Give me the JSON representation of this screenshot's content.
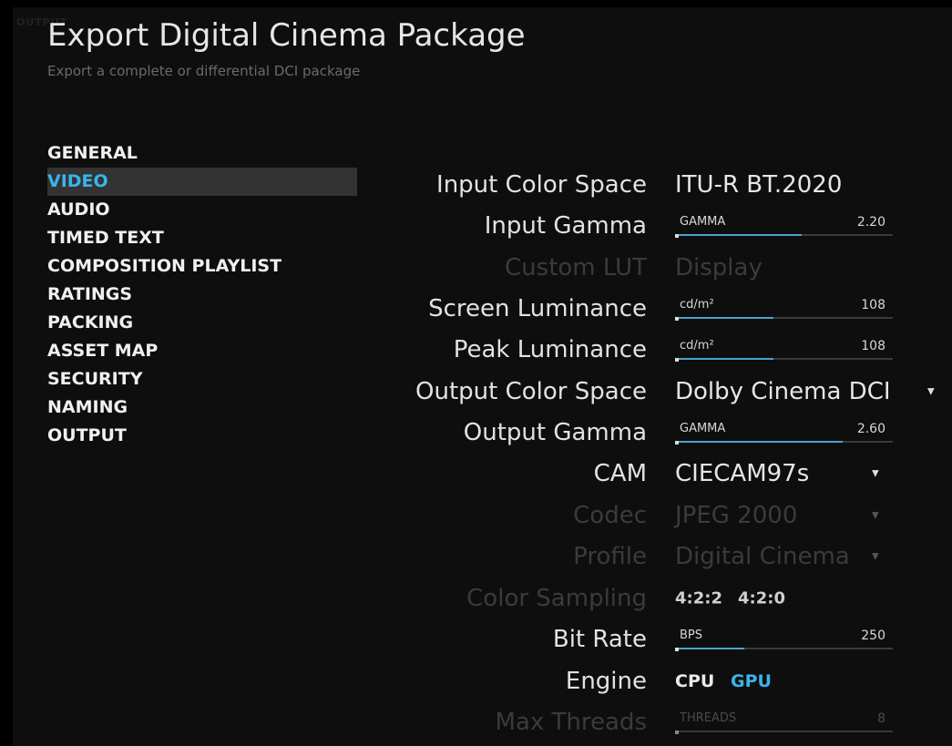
{
  "header": {
    "watermark": "OUTPUT",
    "title": "Export Digital Cinema Package",
    "subtitle": "Export a complete or differential DCI package"
  },
  "nav": {
    "items": [
      {
        "label": "GENERAL"
      },
      {
        "label": "VIDEO",
        "active": true
      },
      {
        "label": "AUDIO"
      },
      {
        "label": "TIMED TEXT"
      },
      {
        "label": "COMPOSITION PLAYLIST"
      },
      {
        "label": "RATINGS"
      },
      {
        "label": "PACKING"
      },
      {
        "label": "ASSET MAP"
      },
      {
        "label": "SECURITY"
      },
      {
        "label": "NAMING"
      },
      {
        "label": "OUTPUT"
      }
    ]
  },
  "settings": {
    "input_color_space": {
      "label": "Input Color Space",
      "value": "ITU-R BT.2020"
    },
    "input_gamma": {
      "label": "Input Gamma",
      "unit": "GAMMA",
      "value": "2.20",
      "fill": 0.58
    },
    "custom_lut": {
      "label": "Custom LUT",
      "value": "Display"
    },
    "screen_luminance": {
      "label": "Screen Luminance",
      "unit": "cd/m²",
      "value": "108",
      "fill": 0.45
    },
    "peak_luminance": {
      "label": "Peak Luminance",
      "unit": "cd/m²",
      "value": "108",
      "fill": 0.45
    },
    "output_color_space": {
      "label": "Output Color Space",
      "value": "Dolby Cinema DCI"
    },
    "output_gamma": {
      "label": "Output Gamma",
      "unit": "GAMMA",
      "value": "2.60",
      "fill": 0.77
    },
    "cam": {
      "label": "CAM",
      "value": "CIECAM97s"
    },
    "codec": {
      "label": "Codec",
      "value": "JPEG 2000"
    },
    "profile": {
      "label": "Profile",
      "value": "Digital Cinema"
    },
    "color_sampling": {
      "label": "Color Sampling",
      "options": [
        "4:2:2",
        "4:2:0"
      ]
    },
    "bit_rate": {
      "label": "Bit Rate",
      "unit": "BPS",
      "value": "250",
      "fill": 0.32
    },
    "engine": {
      "label": "Engine",
      "options": [
        "CPU",
        "GPU"
      ],
      "selected": "GPU"
    },
    "max_threads": {
      "label": "Max Threads",
      "unit": "THREADS",
      "value": "8",
      "fill": 0.0
    }
  },
  "colors": {
    "accent": "#3ab4ea",
    "background": "#0e0e0e",
    "disabled": "#3b3b3b"
  },
  "icons": {
    "dropdown": "caret-down-icon"
  }
}
